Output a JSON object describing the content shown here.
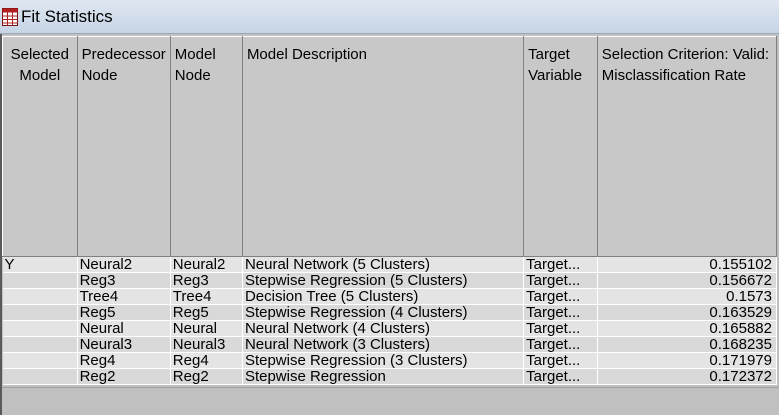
{
  "window": {
    "title": "Fit Statistics",
    "icon": "table-icon"
  },
  "table": {
    "columns": [
      "Selected Model",
      "Predecessor Node",
      "Model Node",
      "Model Description",
      "Target Variable",
      "Selection Criterion: Valid: Misclassification Rate"
    ],
    "rows": [
      {
        "selected": "Y",
        "predecessor": "Neural2",
        "model_node": "Neural2",
        "description": "Neural Network (5 Clusters)",
        "target": "Target...",
        "criterion": "0.155102"
      },
      {
        "selected": "",
        "predecessor": "Reg3",
        "model_node": "Reg3",
        "description": "Stepwise Regression (5 Clusters)",
        "target": "Target...",
        "criterion": "0.156672"
      },
      {
        "selected": "",
        "predecessor": "Tree4",
        "model_node": "Tree4",
        "description": "Decision Tree (5 Clusters)",
        "target": "Target...",
        "criterion": "0.1573"
      },
      {
        "selected": "",
        "predecessor": "Reg5",
        "model_node": "Reg5",
        "description": "Stepwise Regression (4 Clusters)",
        "target": "Target...",
        "criterion": "0.163529"
      },
      {
        "selected": "",
        "predecessor": "Neural",
        "model_node": "Neural",
        "description": "Neural Network (4 Clusters)",
        "target": "Target...",
        "criterion": "0.165882"
      },
      {
        "selected": "",
        "predecessor": "Neural3",
        "model_node": "Neural3",
        "description": "Neural Network (3 Clusters)",
        "target": "Target...",
        "criterion": "0.168235"
      },
      {
        "selected": "",
        "predecessor": "Reg4",
        "model_node": "Reg4",
        "description": "Stepwise Regression (3 Clusters)",
        "target": "Target...",
        "criterion": "0.171979"
      },
      {
        "selected": "",
        "predecessor": "Reg2",
        "model_node": "Reg2",
        "description": "Stepwise Regression",
        "target": "Target...",
        "criterion": "0.172372"
      }
    ]
  }
}
